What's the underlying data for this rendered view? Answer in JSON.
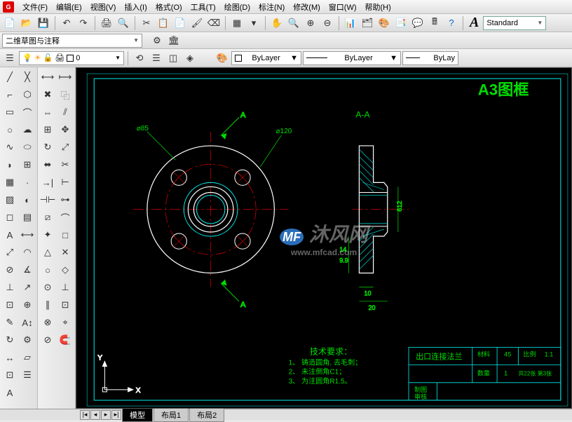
{
  "menu": {
    "items": [
      "文件(F)",
      "编辑(E)",
      "视图(V)",
      "插入(I)",
      "格式(O)",
      "工具(T)",
      "绘图(D)",
      "标注(N)",
      "修改(M)",
      "窗口(W)",
      "帮助(H)"
    ]
  },
  "toolbar1": {
    "style_label": "A",
    "style_value": "Standard"
  },
  "toolbar2": {
    "annotation_mode": "二维草图与注释"
  },
  "toolbar3": {
    "layer_name": "0",
    "color_prop": "ByLayer",
    "linetype_prop": "ByLayer",
    "lineweight_prop": "ByLay"
  },
  "canvas": {
    "frame_title": "A3图框",
    "section_label_top": "A",
    "section_label_bottom": "A",
    "section_view_label": "A-A",
    "dim_85": "⌀85",
    "dim_120": "⌀120",
    "dim_612": "612",
    "dim_14": "14",
    "dim_99": "9.9",
    "dim_10": "10",
    "dim_20": "20",
    "tech_req_title": "技术要求：",
    "tech_req_1": "1、 铸造圆角, 去毛刺；",
    "tech_req_2": "2、 未注倒角C1；",
    "tech_req_3": "3、 为注圆角R1.5。",
    "titleblock": {
      "part_name": "出口连接法兰",
      "material_label": "材料",
      "material_value": "45",
      "scale_label": "比例",
      "scale_value": "1:1",
      "qty_label": "数量",
      "qty_value": "1",
      "sheet_info": "共22张 第3张",
      "drawn_label": "制图",
      "checked_label": "审核"
    },
    "ucs_y": "Y",
    "ucs_x": "X",
    "watermark_main": "沐风网",
    "watermark_sub": "www.mfcad.com"
  },
  "tabs": {
    "model": "模型",
    "layout1": "布局1",
    "layout2": "布局2"
  }
}
